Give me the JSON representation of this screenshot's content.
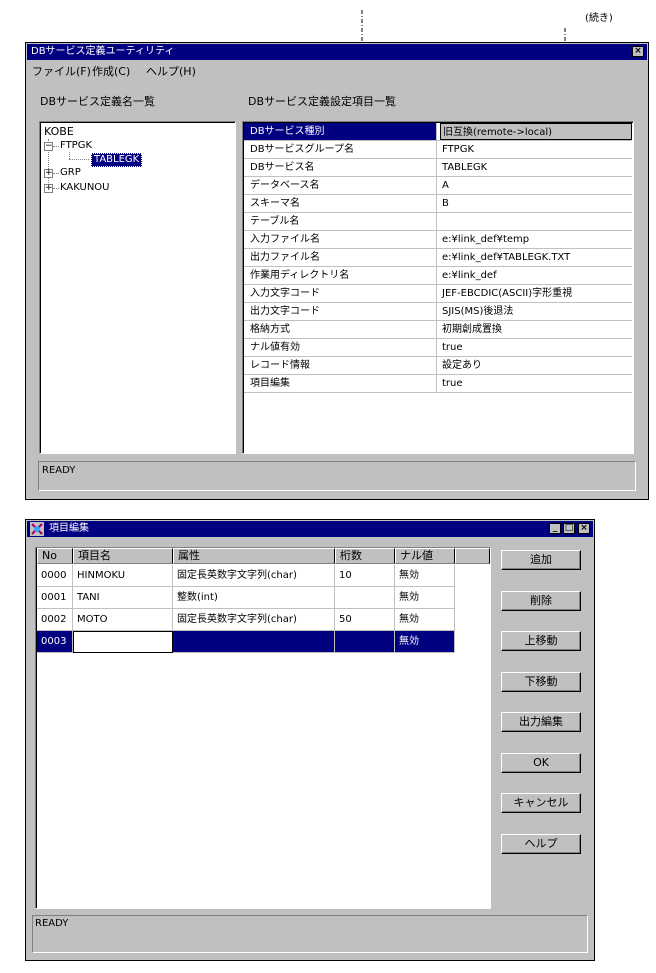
{
  "annotation": {
    "continued": "(続き)"
  },
  "main_window": {
    "title": "DBサービス定義ユーティリティ",
    "menu": [
      "ファイル(F)",
      "作成(C)",
      "ヘルプ(H)"
    ],
    "left_header": "DBサービス定義名一覧",
    "right_header": "DBサービス定義設定項目一覧",
    "tree": {
      "root": "KOBE",
      "nodes": [
        "FTPGK",
        "TABLEGK",
        "GRP",
        "KAKUNOU"
      ]
    },
    "properties": [
      {
        "key": "DBサービス種別",
        "value": "旧互換(remote->local)"
      },
      {
        "key": "DBサービスグループ名",
        "value": "FTPGK"
      },
      {
        "key": "DBサービス名",
        "value": "TABLEGK"
      },
      {
        "key": "データベース名",
        "value": "A"
      },
      {
        "key": "スキーマ名",
        "value": "B"
      },
      {
        "key": "テーブル名",
        "value": ""
      },
      {
        "key": "入力ファイル名",
        "value": "e:¥link_def¥temp"
      },
      {
        "key": "出力ファイル名",
        "value": "e:¥link_def¥TABLEGK.TXT"
      },
      {
        "key": "作業用ディレクトリ名",
        "value": "e:¥link_def"
      },
      {
        "key": "入力文字コード",
        "value": "JEF-EBCDIC(ASCII)字形重視"
      },
      {
        "key": "出力文字コード",
        "value": "SJIS(MS)後退法"
      },
      {
        "key": "格納方式",
        "value": "初期創成置換"
      },
      {
        "key": "ナル値有効",
        "value": "true"
      },
      {
        "key": "レコード情報",
        "value": "設定あり"
      },
      {
        "key": "項目編集",
        "value": "true"
      }
    ],
    "status": "READY",
    "close_glyph": "×"
  },
  "edit_window": {
    "title": "項目編集",
    "columns": [
      "No",
      "項目名",
      "属性",
      "桁数",
      "ナル値"
    ],
    "rows": [
      {
        "no": "0000",
        "name": "HINMOKU",
        "attr": "固定長英数字文字列(char)",
        "digits": "10",
        "null": "無効"
      },
      {
        "no": "0001",
        "name": "TANI",
        "attr": "整数(int)",
        "digits": "",
        "null": "無効"
      },
      {
        "no": "0002",
        "name": "MOTO",
        "attr": "固定長英数字文字列(char)",
        "digits": "50",
        "null": "無効"
      },
      {
        "no": "0003",
        "name": "",
        "attr": "",
        "digits": "",
        "null": "無効"
      }
    ],
    "buttons": [
      "追加",
      "削除",
      "上移動",
      "下移動",
      "出力編集",
      "OK",
      "キャンセル",
      "ヘルプ"
    ],
    "status": "READY",
    "min_glyph": "_",
    "max_glyph": "□",
    "close_glyph": "×"
  }
}
